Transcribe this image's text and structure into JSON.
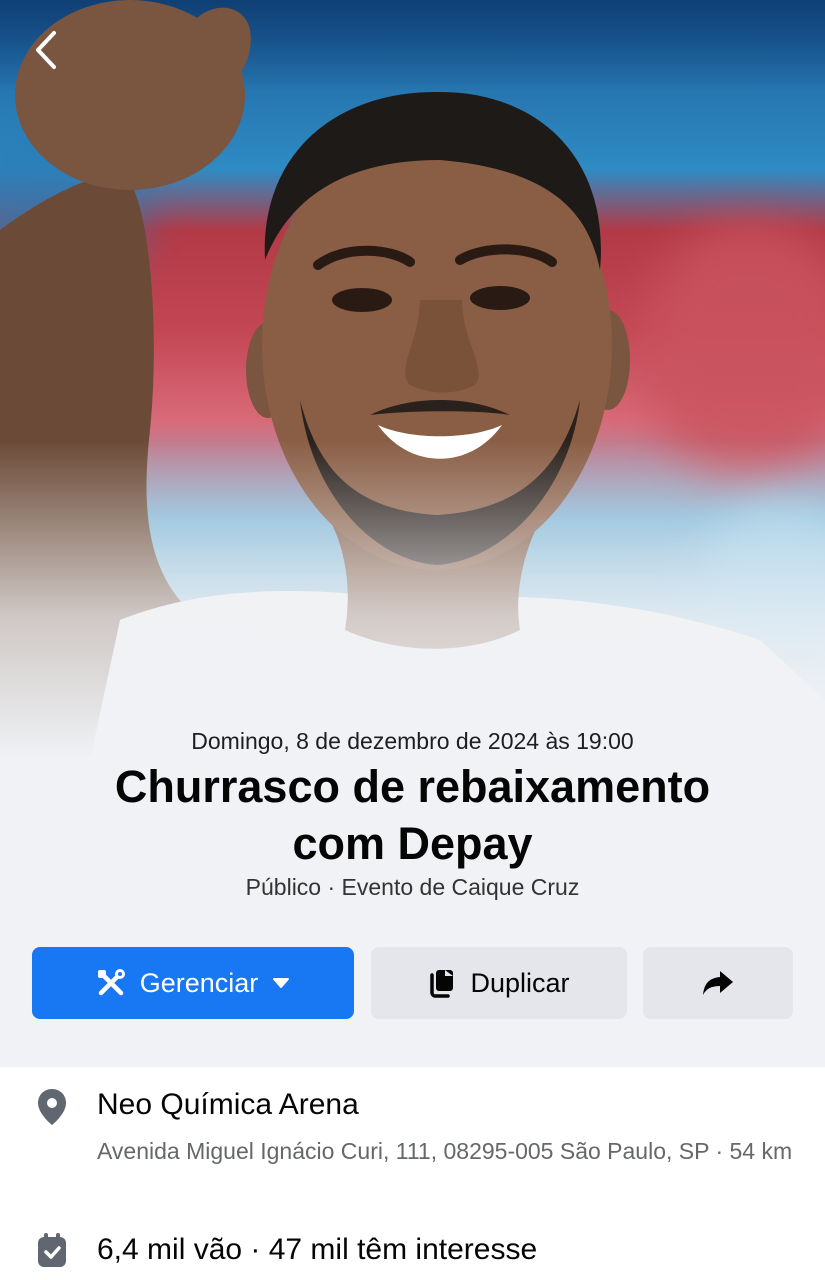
{
  "event": {
    "date_time": "Domingo, 8 de dezembro de 2024 às 19:00",
    "title_line1": "Churrasco de rebaixamento",
    "title_line2": "com Depay",
    "visibility_host": "Público · Evento de Caique Cruz"
  },
  "actions": {
    "manage_label": "Gerenciar",
    "duplicate_label": "Duplicar",
    "share_icon": "share-arrow-icon"
  },
  "location": {
    "name": "Neo Química Arena",
    "address": "Avenida Miguel Ignácio Curi, 111, 08295-005 São Paulo, SP · 54 km"
  },
  "attendance": {
    "summary": "6,4 mil vão · 47 mil têm interesse"
  },
  "colors": {
    "primary": "#1877f2",
    "secondary_button": "#e4e6eb",
    "background": "#f0f2f5"
  }
}
